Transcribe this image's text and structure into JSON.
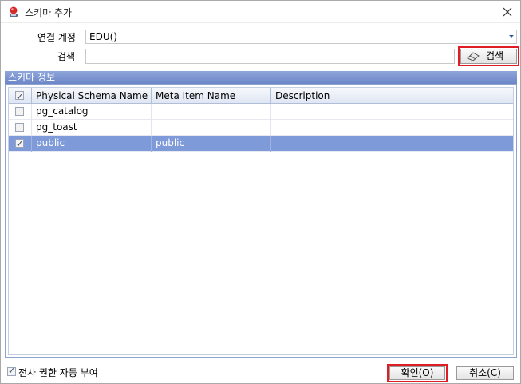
{
  "window": {
    "title": "스키마 추가",
    "close_icon": "close-icon",
    "app_icon": "app-icon"
  },
  "form": {
    "account_label": "연결 계정",
    "account_value": "EDU()",
    "search_label": "검색",
    "search_value": "",
    "search_button": "검색"
  },
  "group": {
    "title": "스키마 정보"
  },
  "table": {
    "columns": [
      "Physical Schema Name",
      "Meta Item Name",
      "Description"
    ],
    "header_checked": true,
    "rows": [
      {
        "checked": false,
        "physical": "pg_catalog",
        "meta": "",
        "description": "",
        "selected": false
      },
      {
        "checked": false,
        "physical": "pg_toast",
        "meta": "",
        "description": "",
        "selected": false
      },
      {
        "checked": true,
        "physical": "public",
        "meta": "public",
        "description": "",
        "selected": true
      }
    ]
  },
  "footer": {
    "auto_grant_checked": true,
    "auto_grant_label": "전사 권한 자동 부여",
    "ok_button": "확인(O)",
    "cancel_button": "취소(C)"
  },
  "colors": {
    "selection": "#7f9ad9",
    "highlight_border": "#e01c24",
    "group_header": "#6c86c8"
  }
}
